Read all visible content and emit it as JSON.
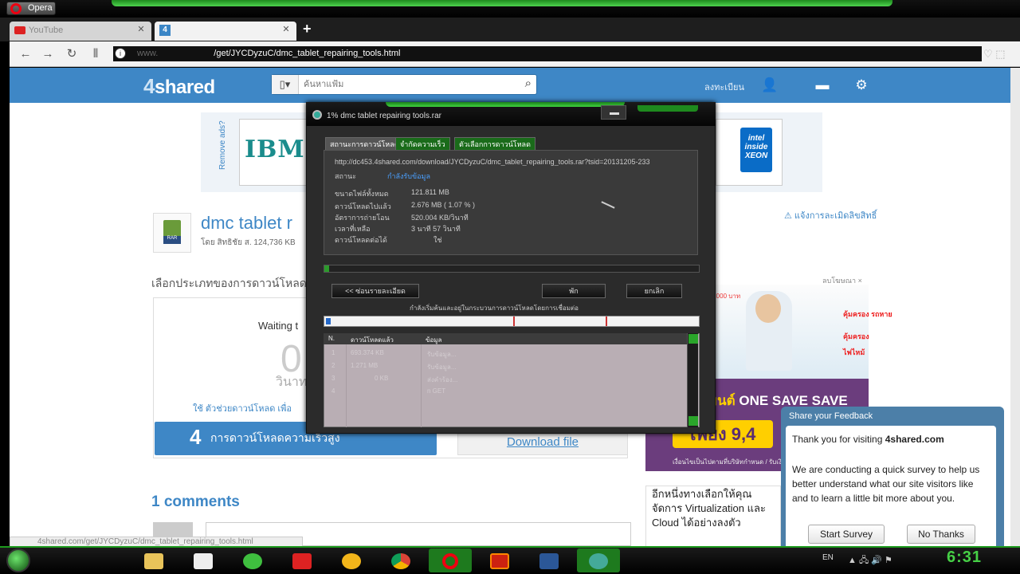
{
  "browser": {
    "menu_label": "Opera",
    "tabs": [
      {
        "label": "YouTube"
      },
      {
        "label": ""
      }
    ],
    "url_prefix": "www.",
    "url_path": "/get/JYCDyzuC/dmc_tablet_repairing_tools.html",
    "new_tab": "+"
  },
  "site": {
    "logo": "shared",
    "logo_num": "4",
    "search_placeholder": "ค้นหาแฟ้ม",
    "login_label": "ลงทะเบียน",
    "remove_ads": "Remove ads?",
    "ibm": "IBM",
    "intel": "intel inside XEON",
    "file_title": "dmc tablet r",
    "file_meta": "โดย สิทธิชัย ส.      124,736 KB",
    "report": "⚠ แจ้งการละเมิดลิขสิทธิ์",
    "choose_type": "เลือกประเภทของการดาวน์โหลด",
    "waiting": "Waiting t",
    "countdown": "0",
    "seconds_label": "วินาท",
    "premium_text": "ใช้ ตัวช่วยดาวน์โหลด เพื่อ",
    "premium_num": "4",
    "premium_btn": "การดาวน์โหลดความเร็วสูง",
    "download_file": "Download file",
    "comments_heading": "1 comments",
    "status_url": "4shared.com/get/JYCDyzuC/dmc_tablet_repairing_tools.html"
  },
  "ads": {
    "close": "ลบโฆษณา ×",
    "price_tag": "1,000 บาท",
    "label1": "คุ้มครอง\nรถหาย",
    "label2": "คุ้มครอง",
    "label3": "ไฟไหม้",
    "promo": "ONE SAVE SAVE",
    "promo_prefix": "ยนต์",
    "price": "เพียง 9,4",
    "small": "เงื่อนไขเป็นไปตามที่บริษัทกำหนด / รับเงินคืน",
    "ad3": "อีกหนึ่งทางเลือกให้คุณจัดการ Virtualization และ Cloud ได้อย่างลงตัว"
  },
  "feedback": {
    "title": "Share your Feedback",
    "thanks": "Thank you for visiting",
    "site": "4shared.com",
    "body": "We are conducting a quick survey to help us better understand what our site visitors like and to learn a little bit more about you.",
    "start": "Start Survey",
    "no": "No Thanks"
  },
  "idm": {
    "title": "1% dmc tablet repairing tools.rar",
    "tab_status": "สถานะการดาวน์โหลด",
    "tab_speed": "จำกัดความเร็ว",
    "tab_options": "ตัวเลือกการดาวน์โหลด",
    "url": "http://dc453.4shared.com/download/JYCDyzuC/dmc_tablet_repairing_tools.rar?tsid=20131205-233",
    "status_label": "สถานะ",
    "status_value": "กำลังรับข้อมูล",
    "rows": [
      {
        "label": "ขนาดไฟล์ทั้งหมด",
        "value": "121.811 MB"
      },
      {
        "label": "ดาวน์โหลดไปแล้ว",
        "value": "2.676 MB ( 1.07 % )"
      },
      {
        "label": "อัตราการถ่ายโอน",
        "value": "520.004 KB/วินาที"
      },
      {
        "label": "เวลาที่เหลือ",
        "value": "3 นาที 57 วินาที"
      },
      {
        "label": "ดาวน์โหลดต่อได้",
        "value": "ใช่"
      }
    ],
    "progress": 0.011,
    "hide_details": "<< ซ่อนรายละเอียด",
    "pause": "พัก",
    "cancel": "ยกเลิก",
    "start_note": "กำลังเริ่มค้นและอยู่ในกระบวนการดาวน์โหลดโดยการเชื่อมต่อ",
    "col_n": "N.",
    "col_downloaded": "ดาวน์โหลดแล้ว",
    "col_info": "ข้อมูล",
    "connections": [
      {
        "n": "1",
        "downloaded": "693.374 KB",
        "info": "รับข้อมูล..."
      },
      {
        "n": "2",
        "downloaded": "1.271 MB",
        "info": "รับข้อมูล..."
      },
      {
        "n": "3",
        "downloaded": "0 KB",
        "info": "ส่งคำร้อง..."
      },
      {
        "n": "4",
        "downloaded": "",
        "info": "n GET"
      }
    ]
  },
  "taskbar": {
    "lang": "EN",
    "clock": "6:31",
    "accent": "#1d9a1d"
  }
}
